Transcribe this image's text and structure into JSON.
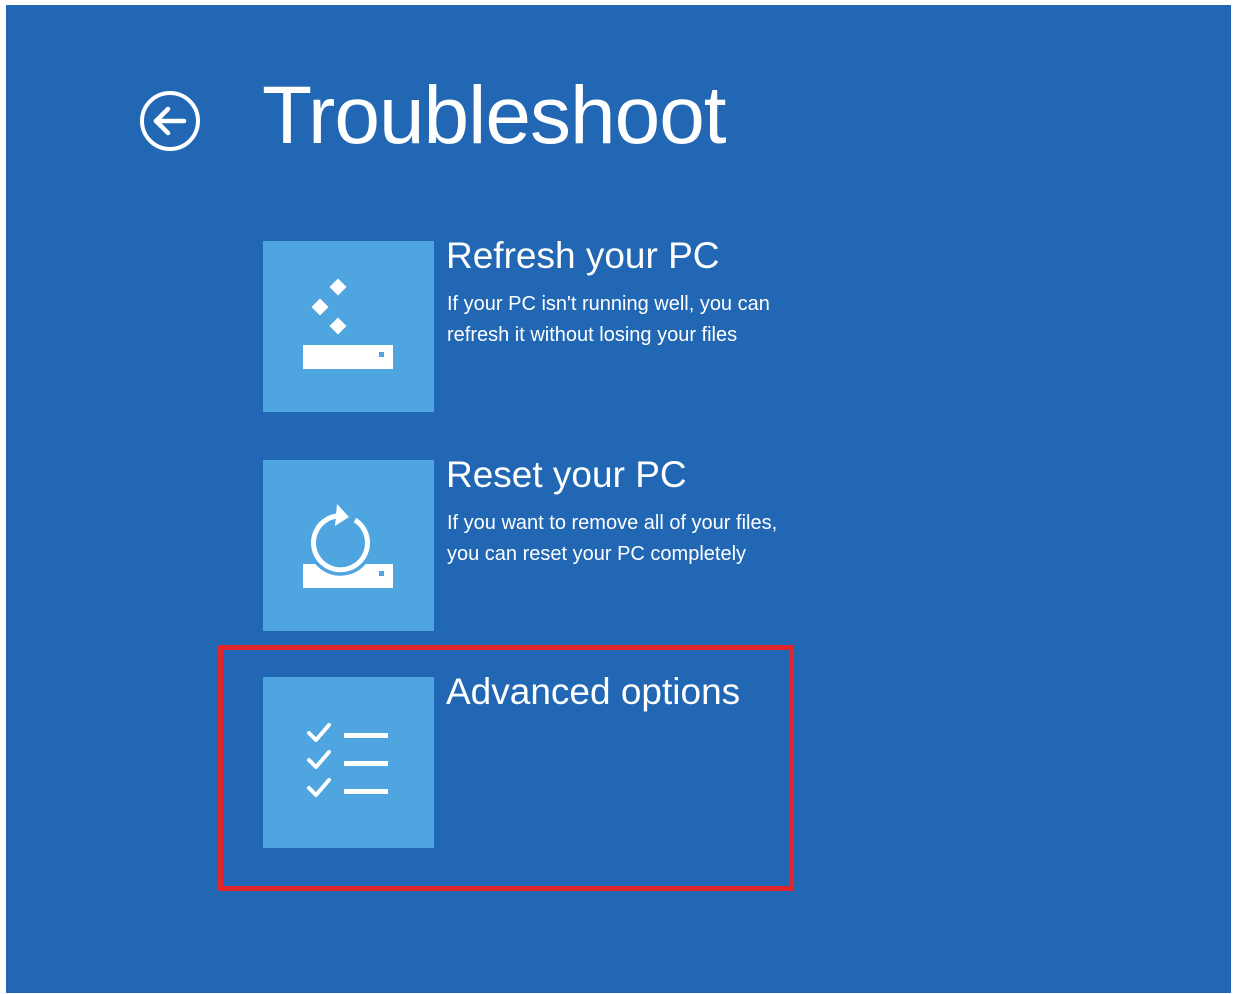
{
  "header": {
    "title": "Troubleshoot",
    "back_icon": "back-arrow-circle-icon"
  },
  "options": [
    {
      "title": "Refresh your PC",
      "description_lines": [
        "If your PC isn't running well, you can",
        "refresh it without losing your files"
      ],
      "icon": "refresh-pc-icon"
    },
    {
      "title": "Reset your PC",
      "description_lines": [
        "If you want to remove all of your files,",
        "you can reset your PC completely"
      ],
      "icon": "reset-pc-icon"
    },
    {
      "title": "Advanced options",
      "description_lines": [],
      "icon": "checklist-icon"
    }
  ],
  "colors": {
    "background": "#2167b3",
    "tile": "#4ea5df",
    "text": "#ffffff",
    "highlight": "#e2252c"
  }
}
